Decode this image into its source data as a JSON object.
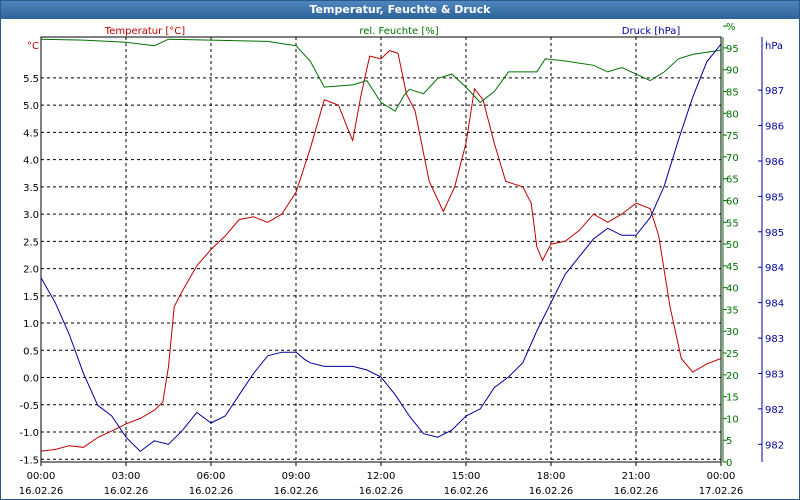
{
  "window": {
    "title": "Temperatur, Feuchte & Druck"
  },
  "legend": {
    "temp": "Temperatur [°C]",
    "hum": "rel. Feuchte [%]",
    "press": "Druck [hPa]"
  },
  "axis_units": {
    "left": "°C",
    "right1": "%",
    "right2": "hPa"
  },
  "colors": {
    "temp": "#c00000",
    "hum": "#007000",
    "press": "#0000a0",
    "title_bg": "#2e6297"
  },
  "chart_data": {
    "type": "line",
    "title": "Temperatur, Feuchte & Druck",
    "grid": true,
    "x": {
      "ticks": [
        {
          "time": "00:00",
          "date": "16.02.26"
        },
        {
          "time": "03:00",
          "date": "16.02.26"
        },
        {
          "time": "06:00",
          "date": "16.02.26"
        },
        {
          "time": "09:00",
          "date": "16.02.26"
        },
        {
          "time": "12:00",
          "date": "16.02.26"
        },
        {
          "time": "15:00",
          "date": "16.02.26"
        },
        {
          "time": "18:00",
          "date": "16.02.26"
        },
        {
          "time": "21:00",
          "date": "16.02.26"
        },
        {
          "time": "00:00",
          "date": "17.02.26"
        }
      ],
      "range_hours": [
        0,
        24
      ]
    },
    "y_left": {
      "label": "°C",
      "range": [
        -1.55,
        6.25
      ],
      "ticks": [
        "-1.5",
        "-1.0",
        "-0.5",
        "0.0",
        "0.5",
        "1.0",
        "1.5",
        "2.0",
        "2.5",
        "3.0",
        "3.5",
        "4.0",
        "4.5",
        "5.0",
        "5.5"
      ]
    },
    "y_right1": {
      "label": "%",
      "range": [
        0,
        97.5
      ],
      "ticks": [
        "0",
        "5",
        "10",
        "15",
        "20",
        "25",
        "30",
        "35",
        "40",
        "45",
        "50",
        "55",
        "60",
        "65",
        "70",
        "75",
        "80",
        "85",
        "90",
        "95",
        "%"
      ]
    },
    "y_right2": {
      "label": "hPa",
      "range": [
        981.75,
        987.75
      ],
      "ticks": [
        "982",
        "982",
        "983",
        "983",
        "984",
        "984",
        "985",
        "985",
        "986",
        "986",
        "987"
      ]
    },
    "series": [
      {
        "name": "Temperatur [°C]",
        "axis": "left",
        "points": [
          [
            0,
            -1.35
          ],
          [
            0.5,
            -1.32
          ],
          [
            1.0,
            -1.25
          ],
          [
            1.5,
            -1.28
          ],
          [
            2.0,
            -1.1
          ],
          [
            2.5,
            -0.98
          ],
          [
            3.0,
            -0.85
          ],
          [
            3.5,
            -0.75
          ],
          [
            4.0,
            -0.6
          ],
          [
            4.3,
            -0.45
          ],
          [
            4.5,
            0.2
          ],
          [
            4.7,
            1.3
          ],
          [
            5.0,
            1.6
          ],
          [
            5.5,
            2.05
          ],
          [
            6.0,
            2.35
          ],
          [
            6.5,
            2.6
          ],
          [
            7.0,
            2.9
          ],
          [
            7.5,
            2.95
          ],
          [
            8.0,
            2.85
          ],
          [
            8.5,
            3.0
          ],
          [
            9.0,
            3.4
          ],
          [
            9.5,
            4.2
          ],
          [
            10.0,
            5.1
          ],
          [
            10.5,
            5.0
          ],
          [
            10.8,
            4.6
          ],
          [
            11.0,
            4.35
          ],
          [
            11.3,
            5.2
          ],
          [
            11.6,
            5.9
          ],
          [
            12.0,
            5.85
          ],
          [
            12.3,
            6.0
          ],
          [
            12.6,
            5.95
          ],
          [
            12.9,
            5.2
          ],
          [
            13.2,
            4.9
          ],
          [
            13.7,
            3.6
          ],
          [
            14.2,
            3.05
          ],
          [
            14.6,
            3.5
          ],
          [
            15.0,
            4.3
          ],
          [
            15.3,
            5.3
          ],
          [
            15.6,
            5.1
          ],
          [
            16.0,
            4.3
          ],
          [
            16.4,
            3.6
          ],
          [
            17.0,
            3.5
          ],
          [
            17.3,
            3.2
          ],
          [
            17.5,
            2.4
          ],
          [
            17.7,
            2.15
          ],
          [
            18.0,
            2.45
          ],
          [
            18.5,
            2.5
          ],
          [
            19.0,
            2.7
          ],
          [
            19.5,
            3.0
          ],
          [
            20.0,
            2.85
          ],
          [
            20.5,
            3.0
          ],
          [
            21.0,
            3.2
          ],
          [
            21.5,
            3.1
          ],
          [
            21.8,
            2.6
          ],
          [
            22.2,
            1.3
          ],
          [
            22.6,
            0.35
          ],
          [
            23.0,
            0.1
          ],
          [
            23.5,
            0.25
          ],
          [
            24.0,
            0.35
          ]
        ]
      },
      {
        "name": "rel. Feuchte [%]",
        "axis": "right1",
        "points": [
          [
            0,
            97
          ],
          [
            1.5,
            96.8
          ],
          [
            3.0,
            96.3
          ],
          [
            4.0,
            95.5
          ],
          [
            4.5,
            97
          ],
          [
            6.0,
            96.8
          ],
          [
            8.0,
            96.5
          ],
          [
            9.0,
            95.5
          ],
          [
            9.5,
            92
          ],
          [
            10.0,
            86
          ],
          [
            11.0,
            86.5
          ],
          [
            11.5,
            87.5
          ],
          [
            12.0,
            82.5
          ],
          [
            12.5,
            80.5
          ],
          [
            12.8,
            84
          ],
          [
            13.0,
            85.5
          ],
          [
            13.5,
            84.5
          ],
          [
            14.0,
            88
          ],
          [
            14.5,
            89
          ],
          [
            15.0,
            86
          ],
          [
            15.5,
            82.5
          ],
          [
            16.0,
            85
          ],
          [
            16.5,
            89.5
          ],
          [
            17.0,
            89.5
          ],
          [
            17.5,
            89.5
          ],
          [
            17.8,
            92.5
          ],
          [
            18.5,
            92
          ],
          [
            19.5,
            91
          ],
          [
            20.0,
            89.5
          ],
          [
            20.5,
            90.5
          ],
          [
            21.0,
            89
          ],
          [
            21.5,
            87.5
          ],
          [
            22.0,
            89.5
          ],
          [
            22.5,
            92.5
          ],
          [
            23.0,
            93.5
          ],
          [
            24.0,
            94.5
          ]
        ]
      },
      {
        "name": "Druck [hPa]",
        "axis": "right2",
        "points": [
          [
            0,
            984.35
          ],
          [
            0.5,
            984.0
          ],
          [
            1.0,
            983.55
          ],
          [
            1.5,
            983.0
          ],
          [
            2.0,
            982.55
          ],
          [
            2.5,
            982.4
          ],
          [
            3.0,
            982.1
          ],
          [
            3.5,
            981.9
          ],
          [
            4.0,
            982.05
          ],
          [
            4.5,
            982.0
          ],
          [
            5.0,
            982.2
          ],
          [
            5.5,
            982.45
          ],
          [
            6.0,
            982.3
          ],
          [
            6.5,
            982.4
          ],
          [
            7.0,
            982.7
          ],
          [
            7.5,
            983.0
          ],
          [
            8.0,
            983.25
          ],
          [
            8.5,
            983.3
          ],
          [
            9.0,
            983.3
          ],
          [
            9.3,
            983.2
          ],
          [
            9.5,
            983.15
          ],
          [
            10.0,
            983.1
          ],
          [
            11.0,
            983.1
          ],
          [
            11.5,
            983.05
          ],
          [
            12.0,
            982.95
          ],
          [
            12.5,
            982.7
          ],
          [
            13.0,
            982.4
          ],
          [
            13.5,
            982.15
          ],
          [
            14.0,
            982.1
          ],
          [
            14.5,
            982.2
          ],
          [
            15.0,
            982.4
          ],
          [
            15.5,
            982.5
          ],
          [
            16.0,
            982.8
          ],
          [
            16.5,
            982.95
          ],
          [
            17.0,
            983.15
          ],
          [
            17.5,
            983.6
          ],
          [
            18.0,
            984.0
          ],
          [
            18.5,
            984.4
          ],
          [
            19.0,
            984.65
          ],
          [
            19.5,
            984.9
          ],
          [
            20.0,
            985.05
          ],
          [
            20.5,
            984.95
          ],
          [
            21.0,
            984.95
          ],
          [
            21.5,
            985.2
          ],
          [
            22.0,
            985.65
          ],
          [
            22.5,
            986.3
          ],
          [
            23.0,
            986.9
          ],
          [
            23.5,
            987.4
          ],
          [
            24.0,
            987.65
          ]
        ]
      }
    ]
  }
}
